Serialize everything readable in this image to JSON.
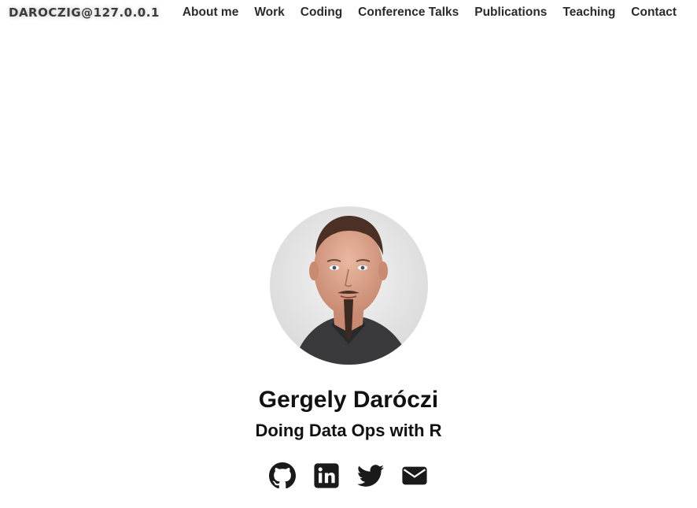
{
  "header": {
    "brand": "DAROCZIG@127.0.0.1",
    "nav": [
      {
        "label": "About me"
      },
      {
        "label": "Work"
      },
      {
        "label": "Coding"
      },
      {
        "label": "Conference Talks"
      },
      {
        "label": "Publications"
      },
      {
        "label": "Teaching"
      },
      {
        "label": "Contact"
      }
    ]
  },
  "profile": {
    "name": "Gergely Daróczi",
    "tagline": "Doing Data Ops with R"
  },
  "socials": [
    {
      "icon": "github-icon"
    },
    {
      "icon": "linkedin-icon"
    },
    {
      "icon": "twitter-icon"
    },
    {
      "icon": "envelope-icon"
    }
  ]
}
